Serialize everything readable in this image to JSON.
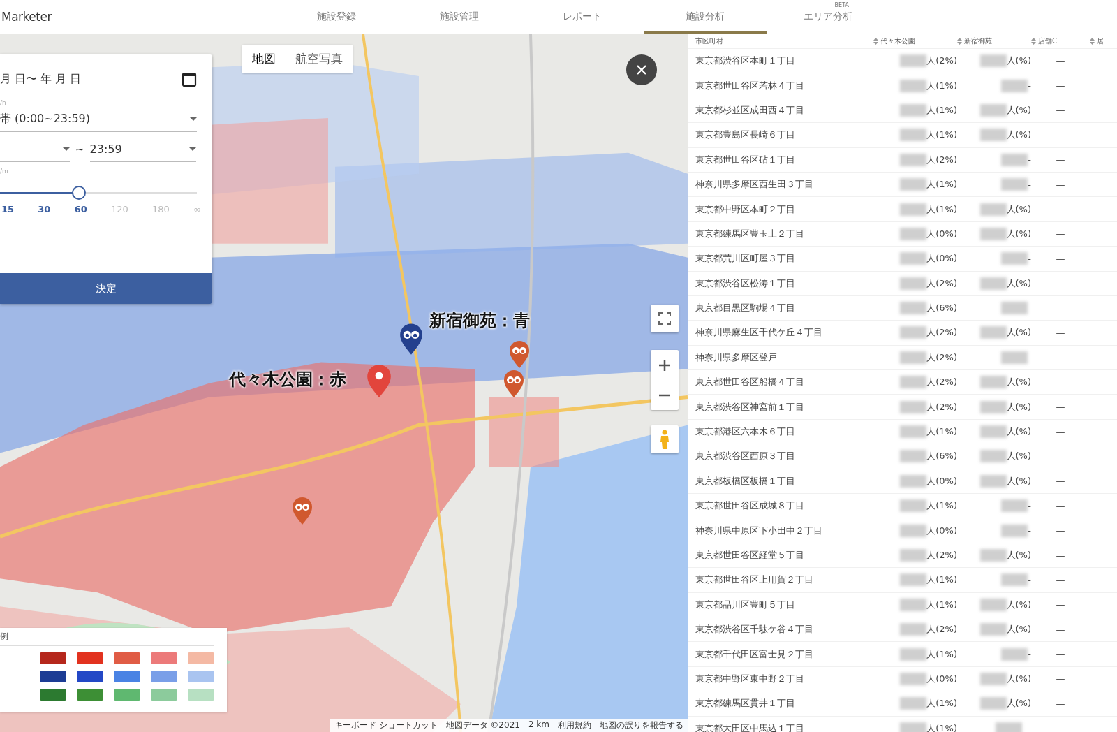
{
  "app": {
    "title": "Marketer"
  },
  "nav_tabs": [
    {
      "label": "施設登録",
      "selected": false
    },
    {
      "label": "施設管理",
      "selected": false
    },
    {
      "label": "レポート",
      "selected": false
    },
    {
      "label": "施設分析",
      "selected": true
    },
    {
      "label": "エリア分析",
      "badge": "BETA",
      "selected": false
    }
  ],
  "filter_panel": {
    "date_range": "月 日〜 年 月 日",
    "time_label": "/h",
    "time_band": "帯 (0:00~23:59)",
    "time_to_separator": "~",
    "time_to": "23:59",
    "duration_label": "/m",
    "duration": {
      "level": 0.4,
      "ticks": [
        "15",
        "30",
        "60",
        "120",
        "180",
        "∞"
      ]
    },
    "submit": "決定"
  },
  "map": {
    "kind": "picture",
    "type_toggle": [
      {
        "label": "地図",
        "selected": true
      },
      {
        "label": "航空写真",
        "selected": false
      }
    ],
    "pins": [
      {
        "kind": "binoculars",
        "color": "#23408e",
        "label": "新宿御苑：青"
      },
      {
        "kind": "drop",
        "color": "#e2453c",
        "label": "代々木公園：赤"
      },
      {
        "kind": "binoculars",
        "color": "#d0582e"
      },
      {
        "kind": "binoculars",
        "color": "#d0582e"
      },
      {
        "kind": "binoculars",
        "color": "#d0582e"
      }
    ],
    "legend": {
      "title": "例",
      "rows": [
        {
          "swatches": [
            {
              "color": "#b5271c"
            },
            {
              "color": "#e2321f"
            },
            {
              "color": "#e05c45"
            },
            {
              "color": "#ec7a7a"
            },
            {
              "color": "#f4b9a4"
            }
          ]
        },
        {
          "swatches": [
            {
              "color": "#1c3c94"
            },
            {
              "color": "#2348c6"
            },
            {
              "color": "#4a83e4"
            },
            {
              "color": "#7a9fe8"
            },
            {
              "color": "#a9c4f0"
            }
          ]
        },
        {
          "swatches": [
            {
              "color": "#2c7a30"
            },
            {
              "color": "#3d8f35"
            },
            {
              "color": "#5fb870"
            },
            {
              "color": "#8ccb9c"
            },
            {
              "color": "#b7e0c2"
            }
          ]
        }
      ]
    },
    "footer": [
      "キーボード ショートカット",
      "地図データ ©2021",
      "2 km",
      "利用規約",
      "地図の誤りを報告する"
    ]
  },
  "table": {
    "columns": [
      "市区町村",
      "代々木公園",
      "新宿御苑",
      "店舗C",
      "居"
    ],
    "rows": [
      {
        "area": "東京都渋谷区本町１丁目",
        "col_1": "人(2%)",
        "col_2": "人(%)",
        "col_3": "—"
      },
      {
        "area": "東京都世田谷区若林４丁目",
        "col_1": "人(1%)",
        "col_2": "-",
        "col_3": "—"
      },
      {
        "area": "東京都杉並区成田西４丁目",
        "col_1": "人(1%)",
        "col_2": "人(%)",
        "col_3": "—"
      },
      {
        "area": "東京都豊島区長崎６丁目",
        "col_1": "人(1%)",
        "col_2": "人(%)",
        "col_3": "—"
      },
      {
        "area": "東京都世田谷区砧１丁目",
        "col_1": "人(2%)",
        "col_2": "-",
        "col_3": "—"
      },
      {
        "area": "神奈川県多摩区西生田３丁目",
        "col_1": "人(1%)",
        "col_2": "-",
        "col_3": "—"
      },
      {
        "area": "東京都中野区本町２丁目",
        "col_1": "人(1%)",
        "col_2": "人(%)",
        "col_3": "—"
      },
      {
        "area": "東京都練馬区豊玉上２丁目",
        "col_1": "人(0%)",
        "col_2": "人(%)",
        "col_3": "—"
      },
      {
        "area": "東京都荒川区町屋３丁目",
        "col_1": "人(0%)",
        "col_2": "-",
        "col_3": "—"
      },
      {
        "area": "東京都渋谷区松涛１丁目",
        "col_1": "人(2%)",
        "col_2": "人(%)",
        "col_3": "—"
      },
      {
        "area": "東京都目黒区駒場４丁目",
        "col_1": "人(6%)",
        "col_2": "-",
        "col_3": "—"
      },
      {
        "area": "神奈川県麻生区千代ケ丘４丁目",
        "col_1": "人(2%)",
        "col_2": "人(%)",
        "col_3": "—"
      },
      {
        "area": "神奈川県多摩区登戸",
        "col_1": "人(2%)",
        "col_2": "-",
        "col_3": "—"
      },
      {
        "area": "東京都世田谷区船橋４丁目",
        "col_1": "人(2%)",
        "col_2": "人(%)",
        "col_3": "—"
      },
      {
        "area": "東京都渋谷区神宮前１丁目",
        "col_1": "人(2%)",
        "col_2": "人(%)",
        "col_3": "—"
      },
      {
        "area": "東京都港区六本木６丁目",
        "col_1": "人(1%)",
        "col_2": "人(%)",
        "col_3": "—"
      },
      {
        "area": "東京都渋谷区西原３丁目",
        "col_1": "人(6%)",
        "col_2": "人(%)",
        "col_3": "—"
      },
      {
        "area": "東京都板橋区板橋１丁目",
        "col_1": "人(0%)",
        "col_2": "人(%)",
        "col_3": "—"
      },
      {
        "area": "東京都世田谷区成城８丁目",
        "col_1": "人(1%)",
        "col_2": "-",
        "col_3": "—"
      },
      {
        "area": "神奈川県中原区下小田中２丁目",
        "col_1": "人(0%)",
        "col_2": "-",
        "col_3": "—"
      },
      {
        "area": "東京都世田谷区経堂５丁目",
        "col_1": "人(2%)",
        "col_2": "人(%)",
        "col_3": "—"
      },
      {
        "area": "東京都世田谷区上用賀２丁目",
        "col_1": "人(1%)",
        "col_2": "-",
        "col_3": "—"
      },
      {
        "area": "東京都品川区豊町５丁目",
        "col_1": "人(1%)",
        "col_2": "人(%)",
        "col_3": "—"
      },
      {
        "area": "東京都渋谷区千駄ケ谷４丁目",
        "col_1": "人(2%)",
        "col_2": "人(%)",
        "col_3": "—"
      },
      {
        "area": "東京都千代田区富士見２丁目",
        "col_1": "人(1%)",
        "col_2": "-",
        "col_3": "—"
      },
      {
        "area": "東京都中野区東中野２丁目",
        "col_1": "人(0%)",
        "col_2": "人(%)",
        "col_3": "—"
      },
      {
        "area": "東京都練馬区貫井１丁目",
        "col_1": "人(1%)",
        "col_2": "人(%)",
        "col_3": "—"
      },
      {
        "area": "東京都大田区中馬込１丁目",
        "col_1": "人(1%)",
        "col_2": "—",
        "col_3": "—"
      }
    ]
  }
}
